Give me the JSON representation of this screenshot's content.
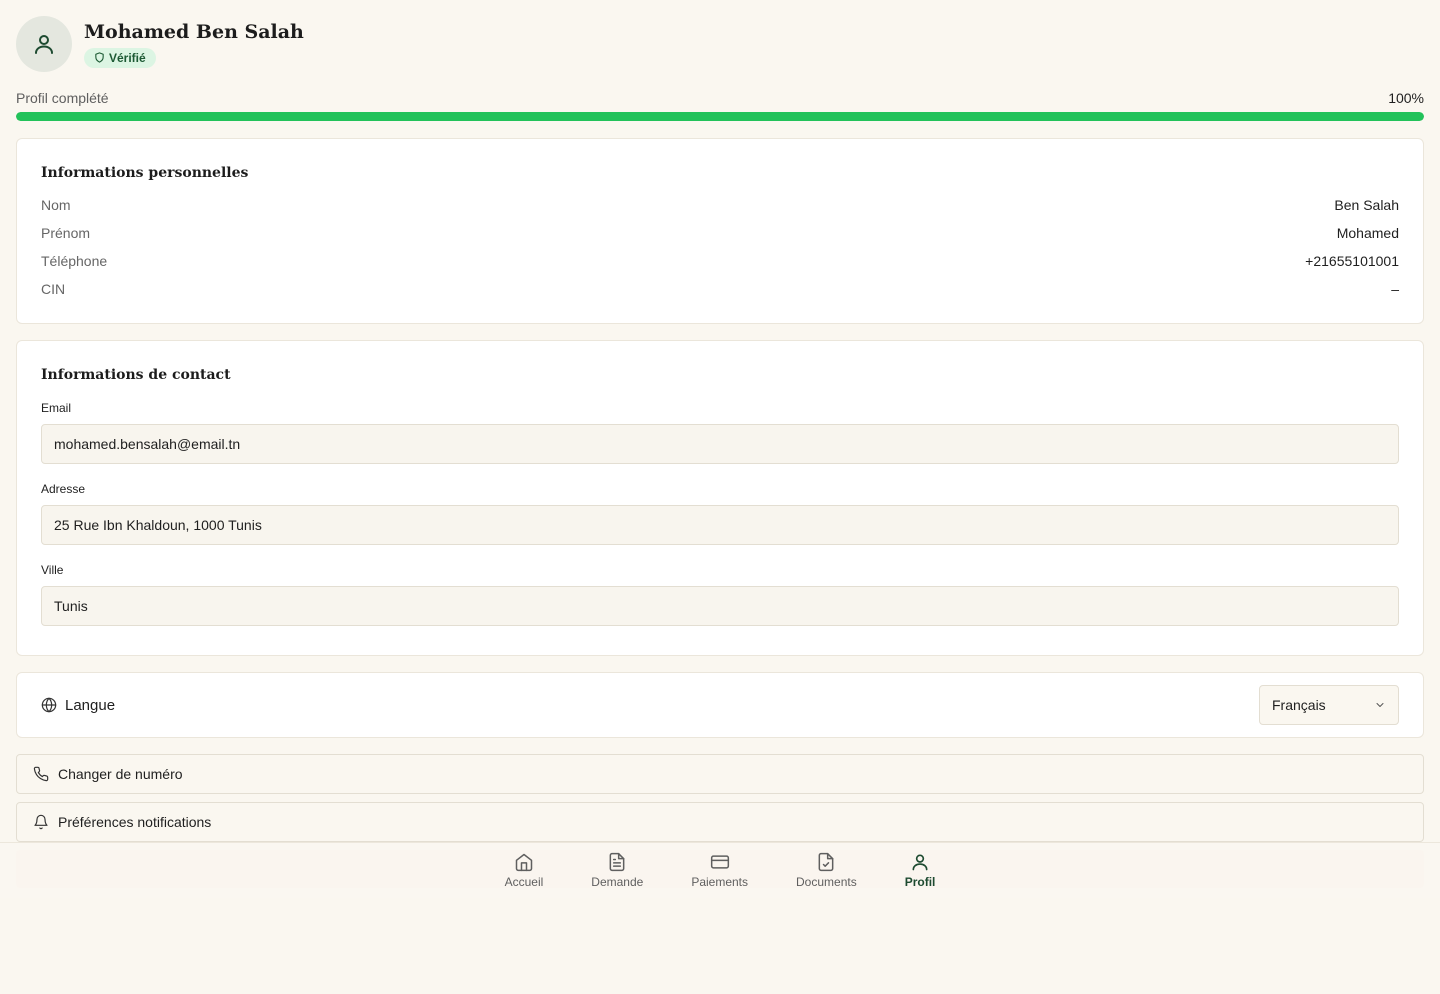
{
  "profile": {
    "name": "Mohamed Ben Salah",
    "badge": "Vérifié",
    "icon": "user-icon"
  },
  "progress": {
    "label": "Profil complété",
    "value_text": "100%",
    "value": 100
  },
  "personal": {
    "title": "Informations personnelles",
    "rows": [
      {
        "label": "Nom",
        "value": "Ben Salah"
      },
      {
        "label": "Prénom",
        "value": "Mohamed"
      },
      {
        "label": "Téléphone",
        "value": "+21655101001"
      },
      {
        "label": "CIN",
        "value": "–"
      }
    ]
  },
  "contact": {
    "title": "Informations de contact",
    "email_label": "Email",
    "email_value": "mohamed.bensalah@email.tn",
    "address_label": "Adresse",
    "address_value": "25 Rue Ibn Khaldoun, 1000 Tunis",
    "city_label": "Ville",
    "city_value": "Tunis"
  },
  "language": {
    "label": "Langue",
    "selected": "Français",
    "icon": "globe-icon"
  },
  "actions": {
    "change_number": "Changer de numéro",
    "notifications": "Préférences notifications"
  },
  "nav": {
    "items": [
      {
        "label": "Accueil",
        "icon": "home-icon"
      },
      {
        "label": "Demande",
        "icon": "document-icon"
      },
      {
        "label": "Paiements",
        "icon": "card-icon"
      },
      {
        "label": "Documents",
        "icon": "file-check-icon"
      },
      {
        "label": "Profil",
        "icon": "user-icon",
        "active": true
      }
    ]
  },
  "colors": {
    "accent": "#22c25a",
    "nav_active": "#1d4a30",
    "badge_bg": "#dcf5e3",
    "background": "#faf7f0"
  }
}
